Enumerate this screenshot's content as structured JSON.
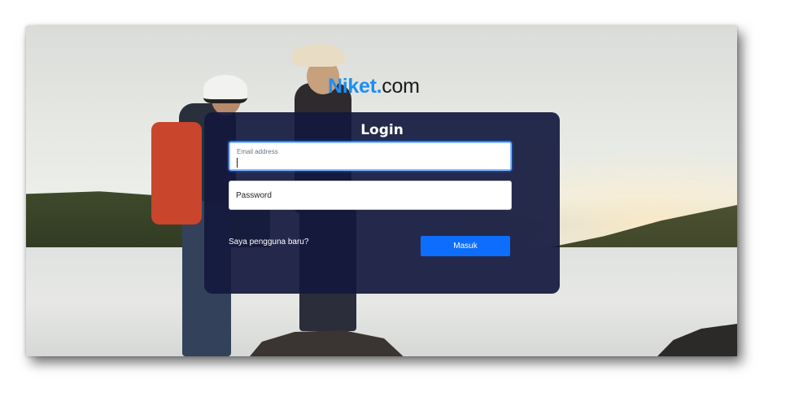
{
  "brand": {
    "part1": "Niket",
    "part2": ".",
    "part3": "com"
  },
  "login": {
    "title": "Login",
    "email_label": "Email address",
    "email_value": "",
    "password_placeholder": "Password",
    "password_value": "",
    "new_user_link": "Saya pengguna baru?",
    "submit_label": "Masuk"
  },
  "colors": {
    "brand_blue": "#1f8ef1",
    "panel_bg": "#14193e",
    "button_blue": "#0d6efd"
  }
}
